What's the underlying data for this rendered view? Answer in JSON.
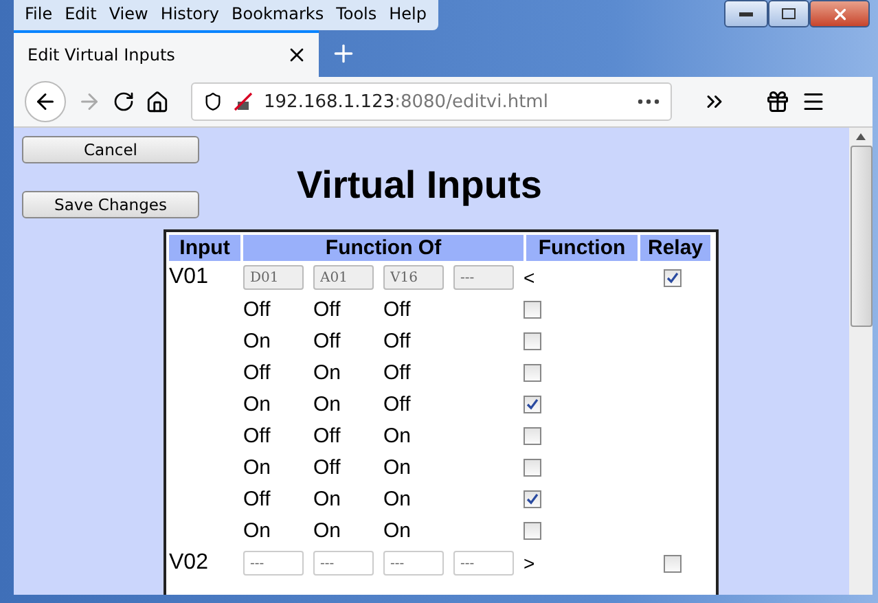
{
  "menu": [
    "File",
    "Edit",
    "View",
    "History",
    "Bookmarks",
    "Tools",
    "Help"
  ],
  "tab": {
    "title": "Edit Virtual Inputs",
    "selected": true
  },
  "address": {
    "host": "192.168.1.123",
    "rest": ":8080/editvi.html"
  },
  "buttons": [
    "Cancel",
    "Save Changes"
  ],
  "heading": "Virtual Inputs",
  "columns": [
    "Input",
    "Function Of",
    "Function",
    "Relay"
  ],
  "rows": [
    {
      "kind": "input",
      "name": "V01",
      "sources": [
        {
          "value": "D01",
          "disabled": true
        },
        {
          "value": "A01",
          "disabled": true
        },
        {
          "value": "V16",
          "disabled": true
        },
        {
          "value": "---",
          "disabled": true
        }
      ],
      "function": "<",
      "relay": true
    },
    {
      "kind": "truth",
      "states": [
        "Off",
        "Off",
        "Off"
      ],
      "checked": false
    },
    {
      "kind": "truth",
      "states": [
        "On",
        "Off",
        "Off"
      ],
      "checked": false
    },
    {
      "kind": "truth",
      "states": [
        "Off",
        "On",
        "Off"
      ],
      "checked": false
    },
    {
      "kind": "truth",
      "states": [
        "On",
        "On",
        "Off"
      ],
      "checked": true
    },
    {
      "kind": "truth",
      "states": [
        "Off",
        "Off",
        "On"
      ],
      "checked": false
    },
    {
      "kind": "truth",
      "states": [
        "On",
        "Off",
        "On"
      ],
      "checked": false
    },
    {
      "kind": "truth",
      "states": [
        "Off",
        "On",
        "On"
      ],
      "checked": true
    },
    {
      "kind": "truth",
      "states": [
        "On",
        "On",
        "On"
      ],
      "checked": false
    },
    {
      "kind": "input",
      "name": "V02",
      "sources": [
        {
          "value": "---",
          "disabled": false
        },
        {
          "value": "---",
          "disabled": false
        },
        {
          "value": "---",
          "disabled": false
        },
        {
          "value": "---",
          "disabled": false
        }
      ],
      "function": ">",
      "relay": false
    }
  ]
}
